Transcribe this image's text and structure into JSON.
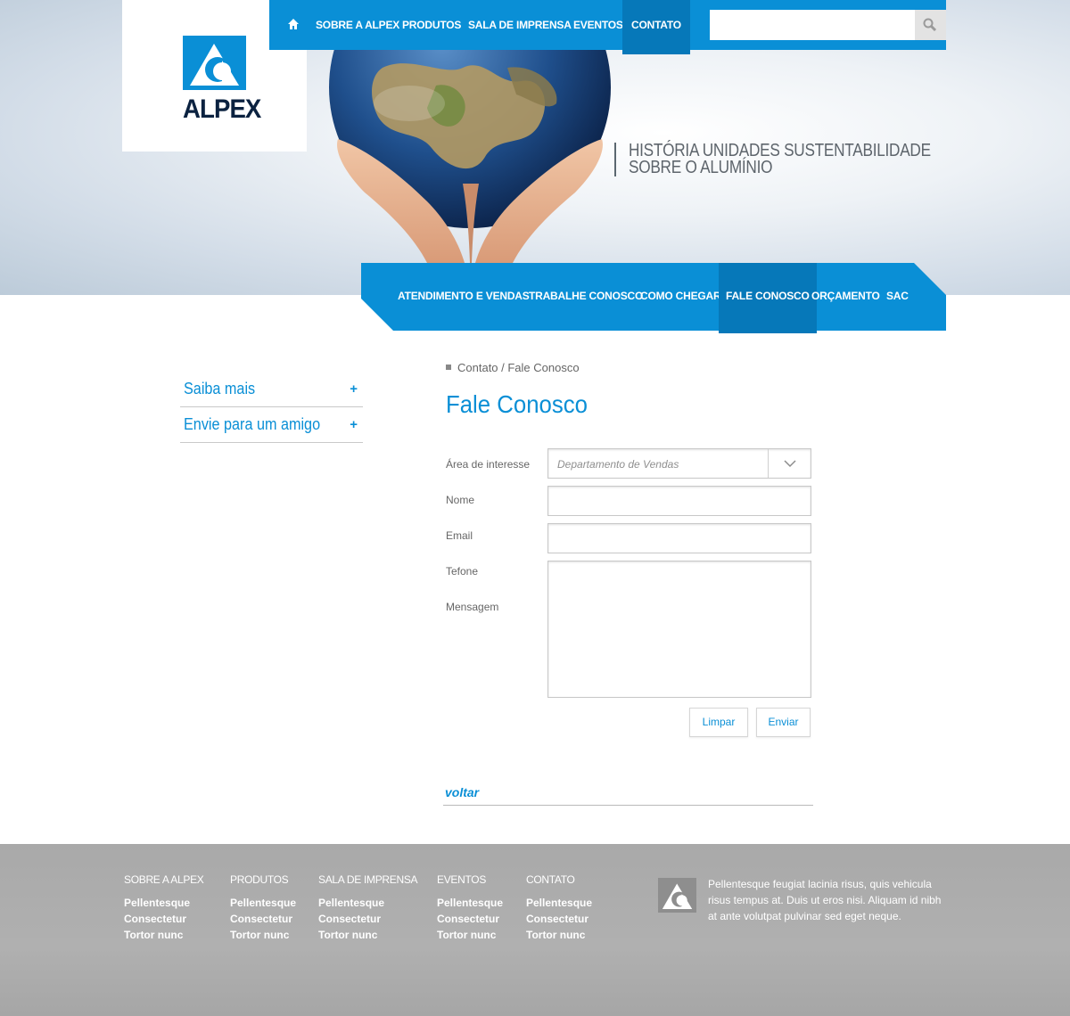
{
  "brand": {
    "name": "ALPEX",
    "accent": "#0a8fd6",
    "accent_dark": "#0678b9",
    "logo_text_color": "#0b2240"
  },
  "topnav": {
    "home_icon": "home-icon",
    "items": [
      "SOBRE A ALPEX",
      "PRODUTOS",
      "SALA DE IMPRENSA",
      "EVENTOS",
      "CONTATO"
    ],
    "active": "CONTATO",
    "search": {
      "value": "",
      "placeholder": "",
      "icon": "search-icon"
    }
  },
  "hero": {
    "taglines": [
      "HISTÓRIA UNIDADES SUSTENTABILIDADE",
      "SOBRE O ALUMÍNIO"
    ]
  },
  "subnav": {
    "items": [
      "ATENDIMENTO E VENDAS",
      "TRABALHE CONOSCO",
      "COMO CHEGAR",
      "FALE CONOSCO",
      "ORÇAMENTO",
      "SAC"
    ],
    "active": "FALE CONOSCO"
  },
  "sidebar": {
    "items": [
      {
        "label": "Saiba mais",
        "toggle": "+"
      },
      {
        "label": "Envie para um amigo",
        "toggle": "+"
      }
    ]
  },
  "main": {
    "breadcrumb": "Contato / Fale Conosco",
    "title": "Fale Conosco",
    "form": {
      "labels": {
        "area": "Área de interesse",
        "name": "Nome",
        "email": "Email",
        "phone": "Tefone",
        "message": "Mensagem"
      },
      "area_selected": "Departamento de Vendas",
      "name_value": "",
      "email_value": "",
      "message_value": "",
      "clear_label": "Limpar",
      "send_label": "Enviar"
    },
    "back_label": "voltar"
  },
  "footer": {
    "columns": [
      {
        "heading": "SOBRE A ALPEX",
        "links": [
          "Pellentesque",
          "Consectetur",
          "Tortor nunc"
        ]
      },
      {
        "heading": "PRODUTOS",
        "links": [
          "Pellentesque",
          "Consectetur",
          "Tortor nunc"
        ]
      },
      {
        "heading": "SALA DE IMPRENSA",
        "links": [
          "Pellentesque",
          "Consectetur",
          "Tortor nunc"
        ]
      },
      {
        "heading": "EVENTOS",
        "links": [
          "Pellentesque",
          "Consectetur",
          "Tortor nunc"
        ]
      },
      {
        "heading": "CONTATO",
        "links": [
          "Pellentesque",
          "Consectetur",
          "Tortor nunc"
        ]
      }
    ],
    "about_text": "Pellentesque feugiat lacinia risus, quis vehicula risus tempus at. Duis ut eros nisi. Aliquam id nibh at ante volutpat pulvinar sed eget neque."
  }
}
